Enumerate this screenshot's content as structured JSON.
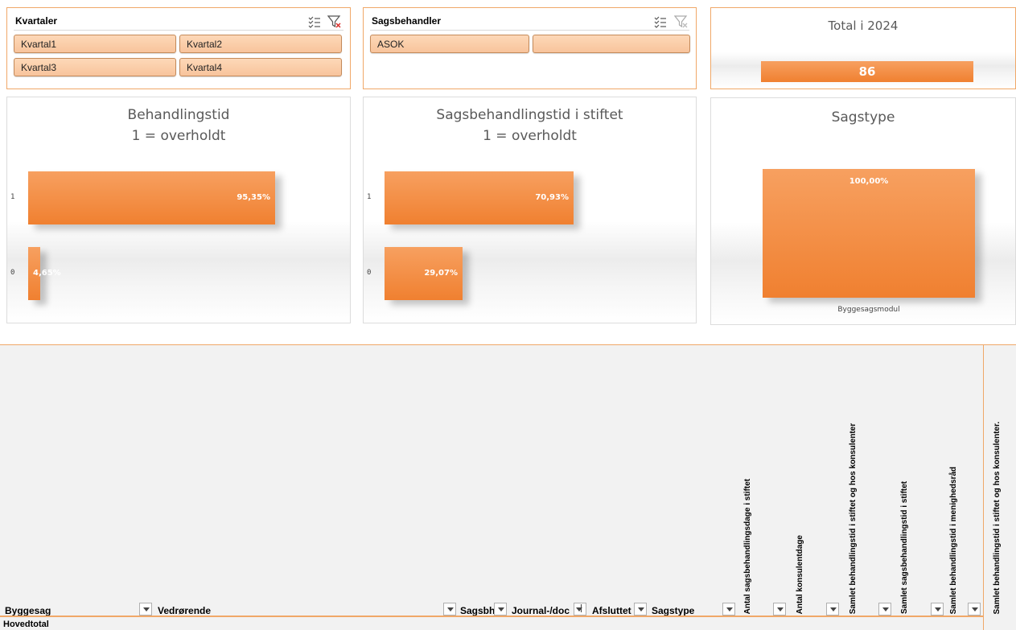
{
  "slicers": {
    "kvartaler": {
      "title": "Kvartaler",
      "items": [
        "Kvartal1",
        "Kvartal2",
        "Kvartal3",
        "Kvartal4"
      ]
    },
    "sagsbehandler": {
      "title": "Sagsbehandler",
      "items": [
        "ASOK",
        ""
      ]
    }
  },
  "total": {
    "title": "Total i 2024",
    "value": "86"
  },
  "charts": {
    "behandlingstid": {
      "title_line1": "Behandlingstid",
      "title_line2": "1 = overholdt"
    },
    "stiftet": {
      "title_line1": "Sagsbehandlingstid i stiftet",
      "title_line2": "1 = overholdt"
    },
    "sagstype": {
      "title_line1": "Sagstype"
    }
  },
  "chart_data": [
    {
      "type": "bar",
      "orientation": "horizontal",
      "title": "Behandlingstid 1 = overholdt",
      "categories": [
        "1",
        "0"
      ],
      "values": [
        95.35,
        4.65
      ],
      "labels": [
        "95,35%",
        "4,65%"
      ],
      "xlim": [
        0,
        100
      ],
      "grid": false,
      "legend": "none"
    },
    {
      "type": "bar",
      "orientation": "horizontal",
      "title": "Sagsbehandlingstid i stiftet 1 = overholdt",
      "categories": [
        "1",
        "0"
      ],
      "values": [
        70.93,
        29.07
      ],
      "labels": [
        "70,93%",
        "29,07%"
      ],
      "xlim": [
        0,
        100
      ],
      "grid": false,
      "legend": "none"
    },
    {
      "type": "bar",
      "orientation": "vertical",
      "title": "Sagstype",
      "categories": [
        "Byggesagsmodul"
      ],
      "values": [
        100.0
      ],
      "labels": [
        "100,00%"
      ],
      "ylim": [
        0,
        100
      ],
      "grid": false,
      "legend": "none"
    }
  ],
  "pivot": {
    "columns": {
      "byggesag": "Byggesag",
      "vedrorende": "Vedrørende",
      "sagsbh": "Sagsbh",
      "journal": "Journal-/doc",
      "afsluttet": "Afsluttet",
      "sagstype": "Sagstype"
    },
    "vertical_headers": [
      "Antal sagsbehandlingsdage i stiftet",
      "Antal konsulentdage",
      "Samlet behandlingstid i stiftet og hos konsulenter",
      "Samlet sagsbehandlingstid i stiftet",
      "Samlet behandlingstid i menighedsråd",
      "Samlet behandlingstid i stiftet og hos konsulenter."
    ],
    "grand_total_label": "Hovedtotal"
  },
  "colors": {
    "accent_orange": "#f08030",
    "slicer_button": "#f8c49c",
    "slicer_border": "#f0a868",
    "title_gray": "#595959"
  }
}
